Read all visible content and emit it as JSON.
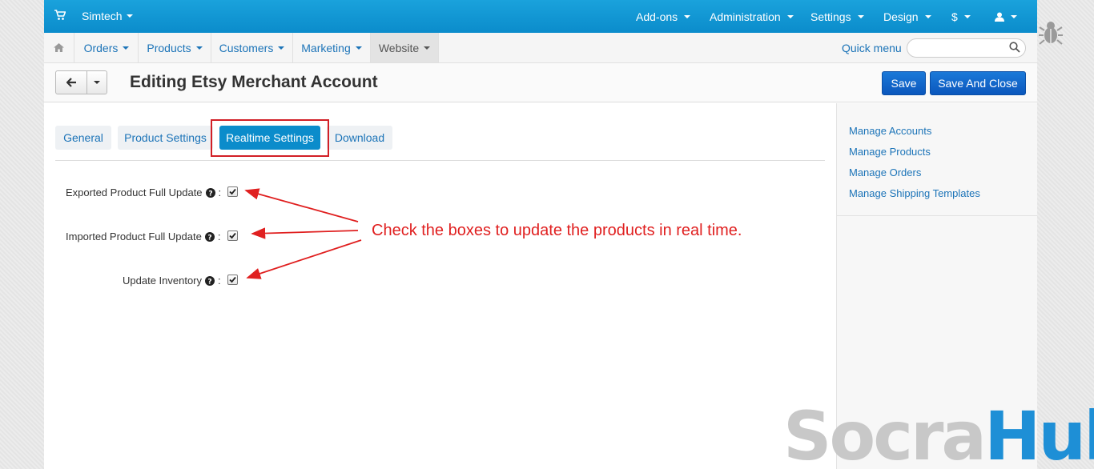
{
  "topbar": {
    "brand": "Simtech",
    "nav": [
      "Add-ons",
      "Administration",
      "Settings",
      "Design",
      "$",
      "user"
    ]
  },
  "mainnav": {
    "items": [
      "Orders",
      "Products",
      "Customers",
      "Marketing",
      "Website"
    ],
    "active": "Website",
    "quick_menu": "Quick menu",
    "search_value": ""
  },
  "header": {
    "title": "Editing Etsy Merchant Account",
    "save": "Save",
    "save_and_close": "Save And Close"
  },
  "tabs": [
    "General",
    "Product Settings",
    "Realtime Settings",
    "Download"
  ],
  "active_tab": "Realtime Settings",
  "fields": [
    {
      "label": "Exported Product Full Update",
      "checked": true
    },
    {
      "label": "Imported Product Full Update",
      "checked": true
    },
    {
      "label": "Update Inventory",
      "checked": true
    }
  ],
  "annotation": "Check the boxes to update the products in real time.",
  "sidebar": {
    "links": [
      "Manage Accounts",
      "Manage Products",
      "Manage Orders",
      "Manage Shipping Templates"
    ]
  },
  "watermark": {
    "part1": "Socra",
    "part2": "Hub"
  },
  "colors": {
    "topbar": "#0b8ccb",
    "link": "#1c74b8",
    "primary": "#0b57bd",
    "annotation": "#e02020",
    "highlight": "#d21f26"
  },
  "icons": [
    "cart-icon",
    "home-icon",
    "search-icon",
    "arrow-left-icon",
    "question-icon",
    "user-icon",
    "bug-icon",
    "checkmark-icon"
  ]
}
